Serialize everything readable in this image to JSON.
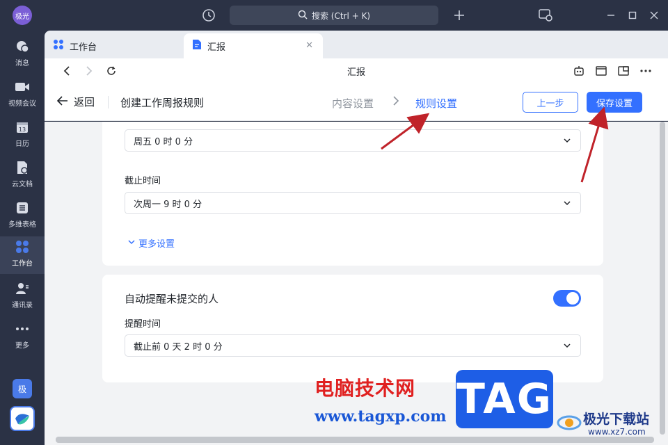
{
  "rail": {
    "avatar": "极光",
    "items": [
      {
        "label": "消息",
        "icon": "chat-icon"
      },
      {
        "label": "视频会议",
        "icon": "video-icon"
      },
      {
        "label": "日历",
        "icon": "calendar-icon",
        "badge": "13"
      },
      {
        "label": "云文档",
        "icon": "doc-icon"
      },
      {
        "label": "多维表格",
        "icon": "table-icon"
      },
      {
        "label": "工作台",
        "icon": "workspace-icon",
        "active": true
      },
      {
        "label": "通讯录",
        "icon": "contacts-icon"
      },
      {
        "label": "更多",
        "icon": "more-icon"
      }
    ],
    "app_badge": "极"
  },
  "topbar": {
    "search_placeholder": "搜索 (Ctrl + K)"
  },
  "tabs": [
    {
      "label": "工作台",
      "icon": "workspace-icon"
    },
    {
      "label": "汇报",
      "icon": "report-icon",
      "active": true
    }
  ],
  "navbar": {
    "title": "汇报"
  },
  "header": {
    "back_label": "返回",
    "page_title": "创建工作周报规则",
    "step1": "内容设置",
    "step2": "规则设置",
    "prev_button": "上一步",
    "save_button": "保存设置"
  },
  "card1": {
    "start_value": "周五 0 时 0 分",
    "deadline_label": "截止时间",
    "deadline_value": "次周一 9 时 0 分",
    "more_settings": "更多设置"
  },
  "card2": {
    "title": "自动提醒未提交的人",
    "toggle_on": true,
    "remind_label": "提醒时间",
    "remind_value": "截止前 0 天 2 时 0 分"
  },
  "watermarks": {
    "site_cn": "电脑技术网",
    "site_url": "www.tagxp.com",
    "tag": "TAG",
    "site2_cn": "极光下载站",
    "site2_url": "www.xz7.com"
  },
  "colors": {
    "accent": "#3370ff",
    "rail_bg": "#2b3245",
    "arrow": "#c0232a"
  }
}
